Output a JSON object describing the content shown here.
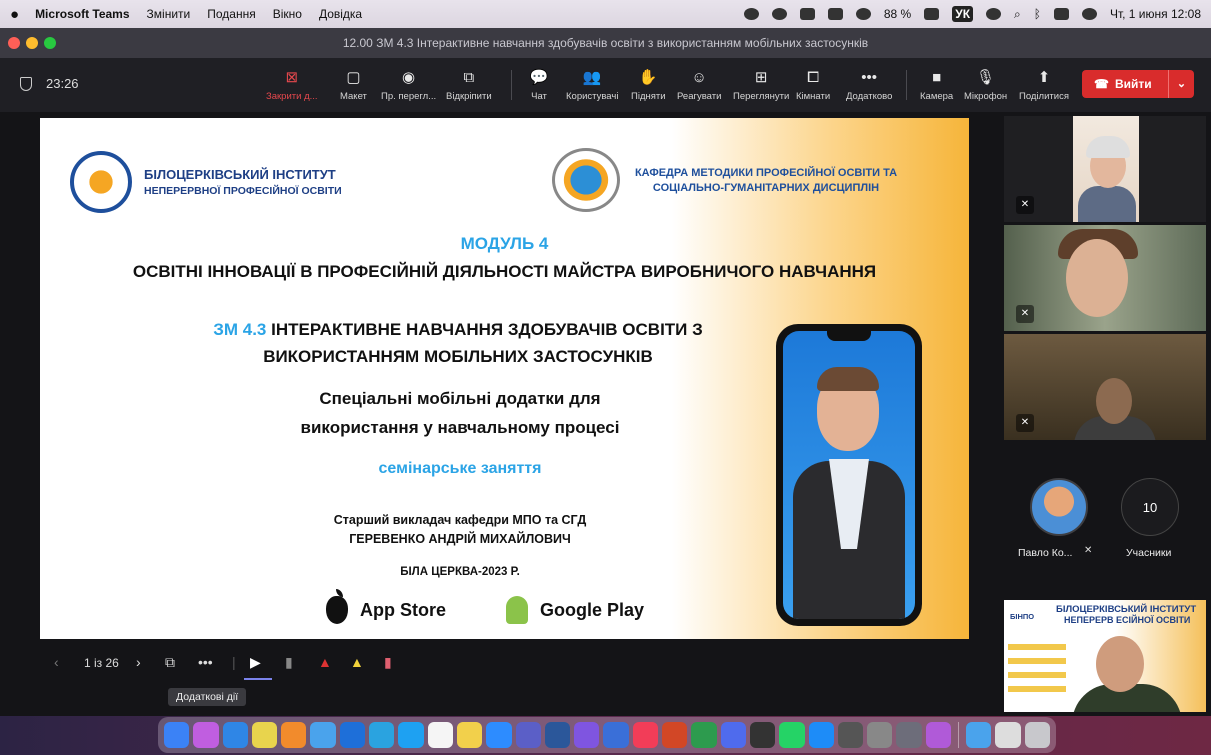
{
  "menubar": {
    "app_name": "Microsoft Teams",
    "items": [
      "Змінити",
      "Подання",
      "Вікно",
      "Довідка"
    ],
    "battery": "88 %",
    "input_source": "УК",
    "clock": "Чт, 1 июня  12:08"
  },
  "window": {
    "title": "12.00 ЗМ 4.3 Інтерактивне навчання здобувачів освіти з використанням мобільних застосунків"
  },
  "toolbar": {
    "timer": "23:26",
    "buttons": [
      {
        "label": "Закрити д...",
        "icon": "close-box-icon"
      },
      {
        "label": "Макет",
        "icon": "layout-icon"
      },
      {
        "label": "Пр. перегл...",
        "icon": "view-icon"
      },
      {
        "label": "Відкріпити",
        "icon": "popout-icon"
      },
      {
        "label": "Чат",
        "icon": "chat-icon"
      },
      {
        "label": "Користувачі",
        "icon": "people-icon"
      },
      {
        "label": "Підняти",
        "icon": "raise-hand-icon"
      },
      {
        "label": "Реагувати",
        "icon": "smile-icon"
      },
      {
        "label": "Переглянути",
        "icon": "grid-icon"
      },
      {
        "label": "Кімнати",
        "icon": "rooms-icon"
      },
      {
        "label": "Додатково",
        "icon": "more-icon"
      },
      {
        "label": "Камера",
        "icon": "camera-icon"
      },
      {
        "label": "Мікрофон",
        "icon": "mic-icon"
      },
      {
        "label": "Поділитися",
        "icon": "share-icon"
      }
    ],
    "leave_label": "Вийти"
  },
  "slide": {
    "institute_line1": "БІЛОЦЕРКІВСЬКИЙ ІНСТИТУТ",
    "institute_line2": "НЕПЕРЕРВНОЇ ПРОФЕСІЙНОЇ ОСВІТИ",
    "dept_line1": "КАФЕДРА МЕТОДИКИ ПРОФЕСІЙНОЇ ОСВІТИ ТА",
    "dept_line2": "СОЦІАЛЬНО-ГУМАНІТАРНИХ ДИСЦИПЛІН",
    "module": "МОДУЛЬ 4",
    "module_title": "ОСВІТНІ ІННОВАЦІЇ В ПРОФЕСІЙНІЙ ДІЯЛЬНОСТІ МАЙСТРА ВИРОБНИЧОГО НАВЧАННЯ",
    "zm_code": "ЗМ 4.3",
    "zm_title_line1": " ІНТЕРАКТИВНЕ НАВЧАННЯ ЗДОБУВАЧІВ ОСВІТИ З",
    "zm_title_line2": "ВИКОРИСТАННЯМ МОБІЛЬНИХ ЗАСТОСУНКІВ",
    "subtitle_line1": "Спеціальні мобільні додатки для",
    "subtitle_line2": "використання у навчальному процесі",
    "seminar": "семінарське заняття",
    "lecturer_line1": "Старший викладач кафедри МПО та СГД",
    "lecturer_line2": "ГЕРЕВЕНКО АНДРІЙ МИХАЙЛОВИЧ",
    "city": "БІЛА ЦЕРКВА-2023 Р.",
    "app_store": "App Store",
    "google_play": "Google Play"
  },
  "participants": {
    "avatar_name": "Павло Ко...",
    "count": "10",
    "count_label": "Учасники",
    "bottom_tile": {
      "badge": "БІНПО",
      "line1": "БІЛОЦЕРКІВСЬКИЙ ІНСТИТУТ",
      "line2": "НЕПЕРЕРВ        ЕСІЙНОЇ ОСВІТИ"
    }
  },
  "presenter": {
    "page": "1 із 26",
    "tooltip": "Додаткові дії"
  },
  "colors": {
    "accent_blue": "#2ba4e6",
    "leave_red": "#d92c2c",
    "toolbar_bg": "#1f1f24"
  }
}
